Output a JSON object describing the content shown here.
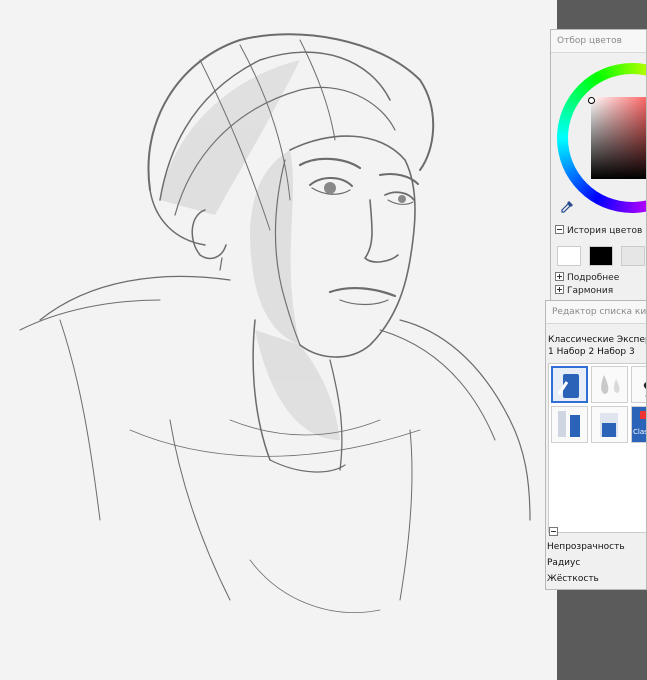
{
  "color_panel": {
    "title": "Отбор цветов",
    "history_label": "История цветов",
    "history_swatches": [
      "#ffffff",
      "#000000",
      "#e6e6e6"
    ],
    "more_label": "Подробнее",
    "harmony_label": "Гармония"
  },
  "brush_panel": {
    "title": "Редактор списка кистей",
    "categories_line": "Классические Эксперимен",
    "sets_line": "1 Набор 2 Набор 3",
    "thumb_label": "Clas",
    "properties": {
      "opacity_label": "Непрозрачность",
      "radius_label": "Радиус",
      "hardness_label": "Жёсткость"
    }
  },
  "colors": {
    "selection_blue": "#2f6fd6",
    "panel_bg": "#f0f0f0",
    "dock_bg": "#5b5b5b",
    "canvas_bg": "#f3f3f3"
  }
}
